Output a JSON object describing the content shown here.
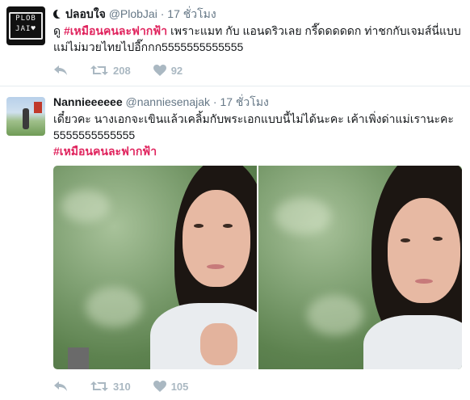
{
  "tweets": [
    {
      "avatar_text_line1": "PLOB",
      "avatar_text_line2": "JAI♥",
      "display_name": "ปลอบใจ",
      "handle": "@PlobJai",
      "separator": "·",
      "time": "17 ชั่วโมง",
      "text_prefix": "ดู ",
      "hashtag": "#เหมือนคนละฟากฟ้า",
      "text_suffix": " เพราะแมท กับ แอนดริวเลย กรี๊ดดดดดก ท่าชกกับเจมส์นี่แบบแม่ไม่มวยไทยไปอี๊กกก5555555555555",
      "retweets": "208",
      "likes": "92"
    },
    {
      "display_name": "Nannieeeeee",
      "handle": "@nanniesenajak",
      "separator": "·",
      "time": "17 ชั่วโมง",
      "text_line1": "เดี๋ยวคะ นางเอกจะเขินแล้วเคลิ้มกับพระเอกแบบนี้ไม่ได้นะคะ เค้าเพิ่งด่าแม่เรานะคะ",
      "text_line2": "5555555555555",
      "hashtag": "#เหมือนคนละฟากฟ้า",
      "retweets": "310",
      "likes": "105"
    }
  ],
  "icons": {
    "reply": "reply-icon",
    "retweet": "retweet-icon",
    "like": "heart-icon"
  },
  "colors": {
    "hashtag": "#e0245e",
    "secondary_text": "#657786",
    "action_icons": "#aab8c2"
  }
}
